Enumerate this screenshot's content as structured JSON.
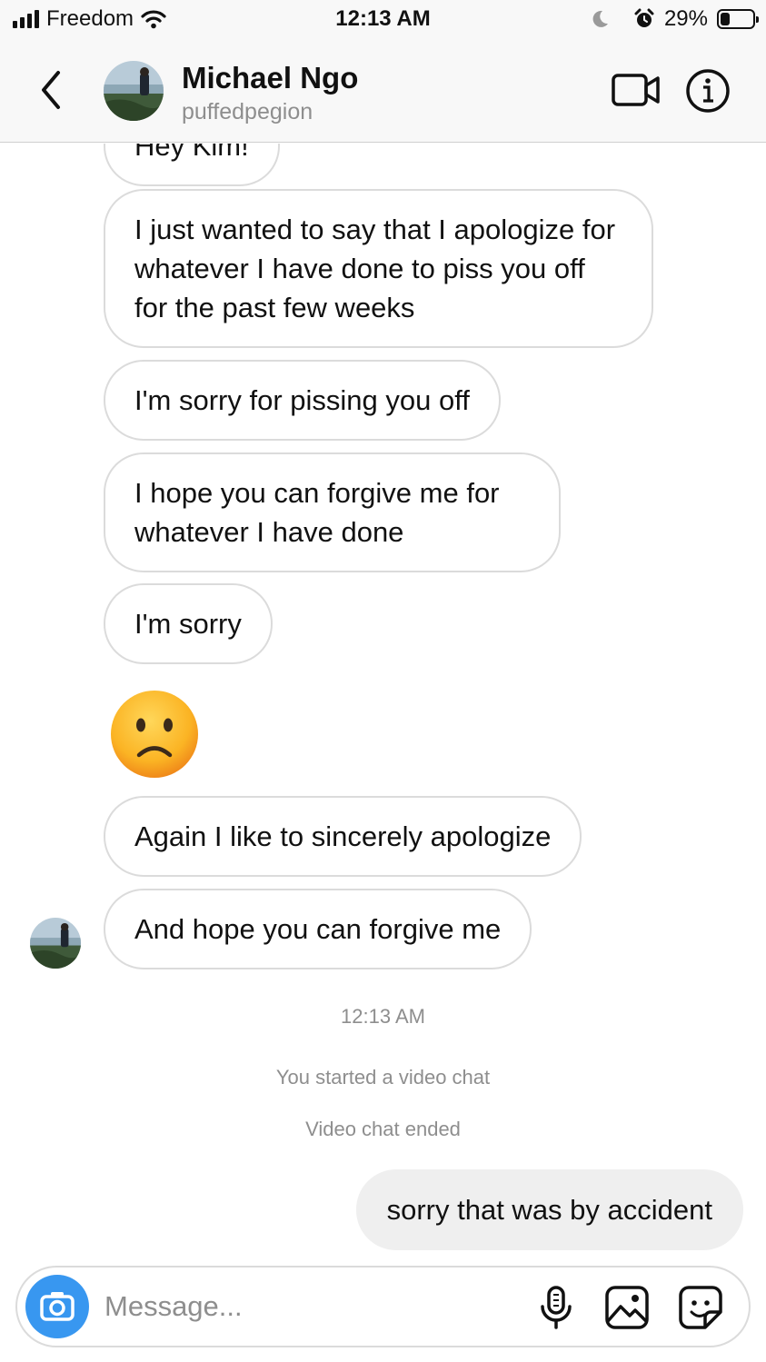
{
  "status_bar": {
    "carrier": "Freedom",
    "time": "12:13 AM",
    "battery_percent": "29%",
    "battery_level": 0.29,
    "icons": [
      "signal-icon",
      "wifi-icon",
      "moon-icon",
      "alarm-icon",
      "battery-icon"
    ]
  },
  "header": {
    "name": "Michael Ngo",
    "username": "puffedpegion",
    "icons": [
      "back-chevron-icon",
      "video-call-icon",
      "info-icon"
    ]
  },
  "messages": {
    "partial": "Hey Kim!",
    "m1": "I just wanted to say that I apologize for whatever I have done to piss you off for the past few weeks",
    "m2": "I'm sorry for pissing you off",
    "m3": "I hope you can forgive me for whatever I have done",
    "m4": "I'm sorry",
    "emoji": "slightly-frowning-face",
    "m5": "Again I like to sincerely apologize",
    "m6": "And hope you can forgive me",
    "timestamp": "12:13 AM",
    "event1": "You started a video chat",
    "event2": "Video chat ended",
    "reply": "sorry that was by accident"
  },
  "composer": {
    "placeholder": "Message...",
    "icons": [
      "camera-icon",
      "microphone-icon",
      "gallery-icon",
      "sticker-icon"
    ]
  },
  "colors": {
    "accent": "#3897f0",
    "bubble_border": "#dbdbdb",
    "own_bubble": "#efefef",
    "secondary_text": "#8e8e8e"
  }
}
